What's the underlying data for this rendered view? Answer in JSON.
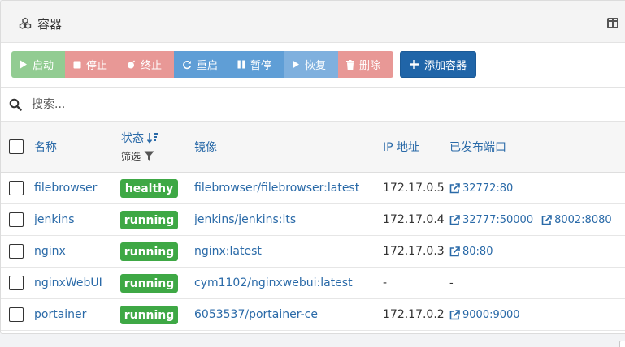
{
  "panel": {
    "title": "容器",
    "title_icon": "cubes-icon",
    "corner_icon": "columns-icon"
  },
  "toolbar": {
    "start": "启动",
    "stop": "停止",
    "kill": "终止",
    "restart": "重启",
    "pause": "暂停",
    "resume": "恢复",
    "remove": "删除",
    "add": "添加容器"
  },
  "search": {
    "placeholder": "搜索..."
  },
  "table": {
    "columns": {
      "name": "名称",
      "state": "状态",
      "filter": "筛选",
      "image": "镜像",
      "ip": "IP 地址",
      "ports": "已发布端口"
    },
    "rows": [
      {
        "name": "filebrowser",
        "status": "healthy",
        "image": "filebrowser/filebrowser:latest",
        "ip": "172.17.0.5",
        "ports": [
          "32772:80"
        ]
      },
      {
        "name": "jenkins",
        "status": "running",
        "image": "jenkins/jenkins:lts",
        "ip": "172.17.0.4",
        "ports": [
          "32777:50000",
          "8002:8080"
        ]
      },
      {
        "name": "nginx",
        "status": "running",
        "image": "nginx:latest",
        "ip": "172.17.0.3",
        "ports": [
          "80:80"
        ]
      },
      {
        "name": "nginxWebUI",
        "status": "running",
        "image": "cym1102/nginxwebui:latest",
        "ip": "-",
        "ports": [
          "-"
        ]
      },
      {
        "name": "portainer",
        "status": "running",
        "image": "6053537/portainer-ce",
        "ip": "172.17.0.2",
        "ports": [
          "9000:9000"
        ]
      }
    ]
  },
  "colors": {
    "link": "#2a6aa8",
    "status_green": "#3ea845",
    "add_button": "#2065a8"
  }
}
